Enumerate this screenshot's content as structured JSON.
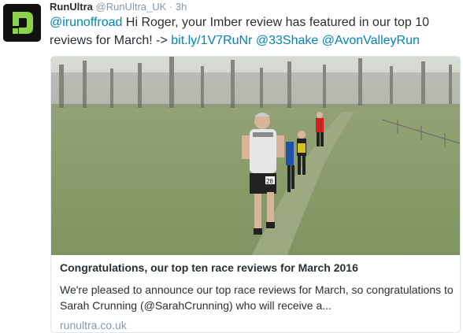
{
  "tweet": {
    "author_name": "RunUltra",
    "author_handle": "@RunUltra_UK",
    "separator": "·",
    "time": "3h",
    "text_parts": {
      "mention": "@irunoffroad",
      "body": " Hi Roger, your Imber review has featured in our top 10 reviews for March! -> ",
      "link": "bit.ly/1V7RuNr",
      "mention2": "@33Shake",
      "mention3": "@AvonValleyRun"
    }
  },
  "avatar": {
    "icon": "runultra-logo-icon",
    "colors": {
      "background": "#111111",
      "logo": "#8ed14b"
    }
  },
  "card": {
    "image_label": "runners-on-grass-trail-photo",
    "runner_bib": "28",
    "title": "Congratulations, our top ten race reviews for March 2016",
    "description": "We're pleased to announce our top race reviews for March, so congratulations to Sarah Crunning (@SarahCrunning) who will receive a...",
    "domain": "runultra.co.uk"
  },
  "colors": {
    "link": "#0084b4",
    "muted": "#8899a6",
    "text": "#292f33"
  }
}
